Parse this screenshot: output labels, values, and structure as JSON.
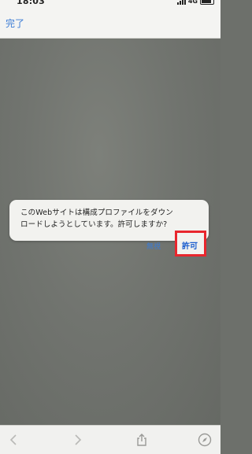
{
  "status_bar": {
    "time": "18:03",
    "network": "4G"
  },
  "nav": {
    "done_label": "完了"
  },
  "dialog": {
    "message_line1": "このWebサイトは構成プロファイルをダウン",
    "message_line2": "ロードしようとしています。許可しますか?",
    "ignore_label": "無視",
    "allow_label": "許可"
  },
  "toolbar": {
    "icons": [
      "chevron-left-icon",
      "chevron-right-icon",
      "share-icon",
      "compass-icon"
    ]
  },
  "colors": {
    "accent": "#3a7bd5",
    "highlight": "#e8262d"
  }
}
